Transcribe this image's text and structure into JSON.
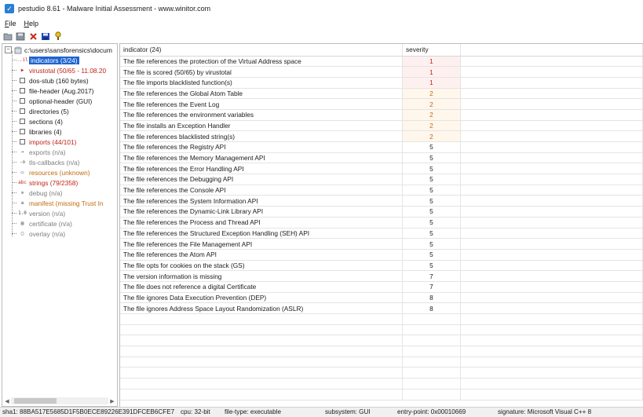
{
  "window": {
    "title": "pestudio 8.61 - Malware Initial Assessment - www.winitor.com"
  },
  "menu": [
    {
      "accel": "F",
      "rest": "ile"
    },
    {
      "accel": "H",
      "rest": "elp"
    }
  ],
  "toolbar": [
    "open-icon",
    "save-icon",
    "delete-icon",
    "floppy-icon",
    "help-icon"
  ],
  "tree": {
    "root": "c:\\users\\sansforensics\\docum",
    "items": [
      {
        "label": "indicators (3/24)",
        "style": "sel",
        "icon": "indicator-icon",
        "glyph": "..il"
      },
      {
        "label": "virustotal (50/65 - 11.08.20",
        "style": "red",
        "icon": "virustotal-icon",
        "glyph": "▶"
      },
      {
        "label": "dos-stub (160 bytes)",
        "style": "normal",
        "icon": "box-icon",
        "glyph": ""
      },
      {
        "label": "file-header (Aug.2017)",
        "style": "normal",
        "icon": "box-icon",
        "glyph": ""
      },
      {
        "label": "optional-header (GUI)",
        "style": "normal",
        "icon": "box-icon",
        "glyph": ""
      },
      {
        "label": "directories (5)",
        "style": "normal",
        "icon": "box-icon",
        "glyph": ""
      },
      {
        "label": "sections (4)",
        "style": "normal",
        "icon": "box-icon",
        "glyph": ""
      },
      {
        "label": "libraries (4)",
        "style": "normal",
        "icon": "box-icon",
        "glyph": ""
      },
      {
        "label": "imports (44/101)",
        "style": "red",
        "icon": "box-icon",
        "glyph": ""
      },
      {
        "label": "exports (n/a)",
        "style": "grey",
        "icon": "export-icon",
        "glyph": "→"
      },
      {
        "label": "tls-callbacks (n/a)",
        "style": "grey",
        "icon": "callback-icon",
        "glyph": "-o"
      },
      {
        "label": "resources (unknown)",
        "style": "orange",
        "icon": "resource-icon",
        "glyph": "▭"
      },
      {
        "label": "strings (79/2358)",
        "style": "red",
        "icon": "strings-icon",
        "glyph": "abc"
      },
      {
        "label": "debug (n/a)",
        "style": "grey",
        "icon": "debug-icon",
        "glyph": "✲"
      },
      {
        "label": "manifest (missing Trust In",
        "style": "orange",
        "icon": "manifest-icon",
        "glyph": "≡"
      },
      {
        "label": "version (n/a)",
        "style": "grey",
        "icon": "version-icon",
        "glyph": "1.0"
      },
      {
        "label": "certificate (n/a)",
        "style": "grey",
        "icon": "certificate-icon",
        "glyph": "▤"
      },
      {
        "label": "overlay (n/a)",
        "style": "grey",
        "icon": "overlay-icon",
        "glyph": "▢"
      }
    ]
  },
  "grid": {
    "col_indicator": "indicator (24)",
    "col_severity": "severity",
    "rows": [
      {
        "indicator": "The file references the protection of the Virtual Address space",
        "severity": "1"
      },
      {
        "indicator": "The file is scored (50/65) by virustotal",
        "severity": "1"
      },
      {
        "indicator": "The file imports blacklisted function(s)",
        "severity": "1"
      },
      {
        "indicator": "The file references the Global Atom Table",
        "severity": "2"
      },
      {
        "indicator": "The file references the Event Log",
        "severity": "2"
      },
      {
        "indicator": "The file references the environment variables",
        "severity": "2"
      },
      {
        "indicator": "The file installs an Exception Handler",
        "severity": "2"
      },
      {
        "indicator": "The file references blacklisted string(s)",
        "severity": "2"
      },
      {
        "indicator": "The file references the Registry API",
        "severity": "5"
      },
      {
        "indicator": "The file references the Memory Management API",
        "severity": "5"
      },
      {
        "indicator": "The file references the Error Handling API",
        "severity": "5"
      },
      {
        "indicator": "The file references the Debugging API",
        "severity": "5"
      },
      {
        "indicator": "The file references the Console API",
        "severity": "5"
      },
      {
        "indicator": "The file references the System Information API",
        "severity": "5"
      },
      {
        "indicator": "The file references the Dynamic-Link Library API",
        "severity": "5"
      },
      {
        "indicator": "The file references the Process and Thread API",
        "severity": "5"
      },
      {
        "indicator": "The file references the Structured Exception Handling (SEH) API",
        "severity": "5"
      },
      {
        "indicator": "The file references the File Management API",
        "severity": "5"
      },
      {
        "indicator": "The file references the Atom API",
        "severity": "5"
      },
      {
        "indicator": "The file opts for cookies on the stack (GS)",
        "severity": "5"
      },
      {
        "indicator": "The version information is missing",
        "severity": "7"
      },
      {
        "indicator": "The file does not reference a digital Certificate",
        "severity": "7"
      },
      {
        "indicator": "The file ignores Data Execution Prevention (DEP)",
        "severity": "8"
      },
      {
        "indicator": "The file ignores Address Space Layout Randomization (ASLR)",
        "severity": "8"
      }
    ]
  },
  "status": {
    "sha1": "sha1: 88BA517E5685D1F5B0ECE89226E391DFCEB6CFE7",
    "cpu": "cpu: 32-bit",
    "filetype": "file-type: executable",
    "subsystem": "subsystem: GUI",
    "entrypoint": "entry-point: 0x00010669",
    "signature": "signature: Microsoft Visual C++ 8"
  },
  "colors": {
    "selection": "#1e63cf",
    "severity_high": "#c0241a",
    "severity_medium": "#c26b0e",
    "muted": "#7d7d7d"
  }
}
